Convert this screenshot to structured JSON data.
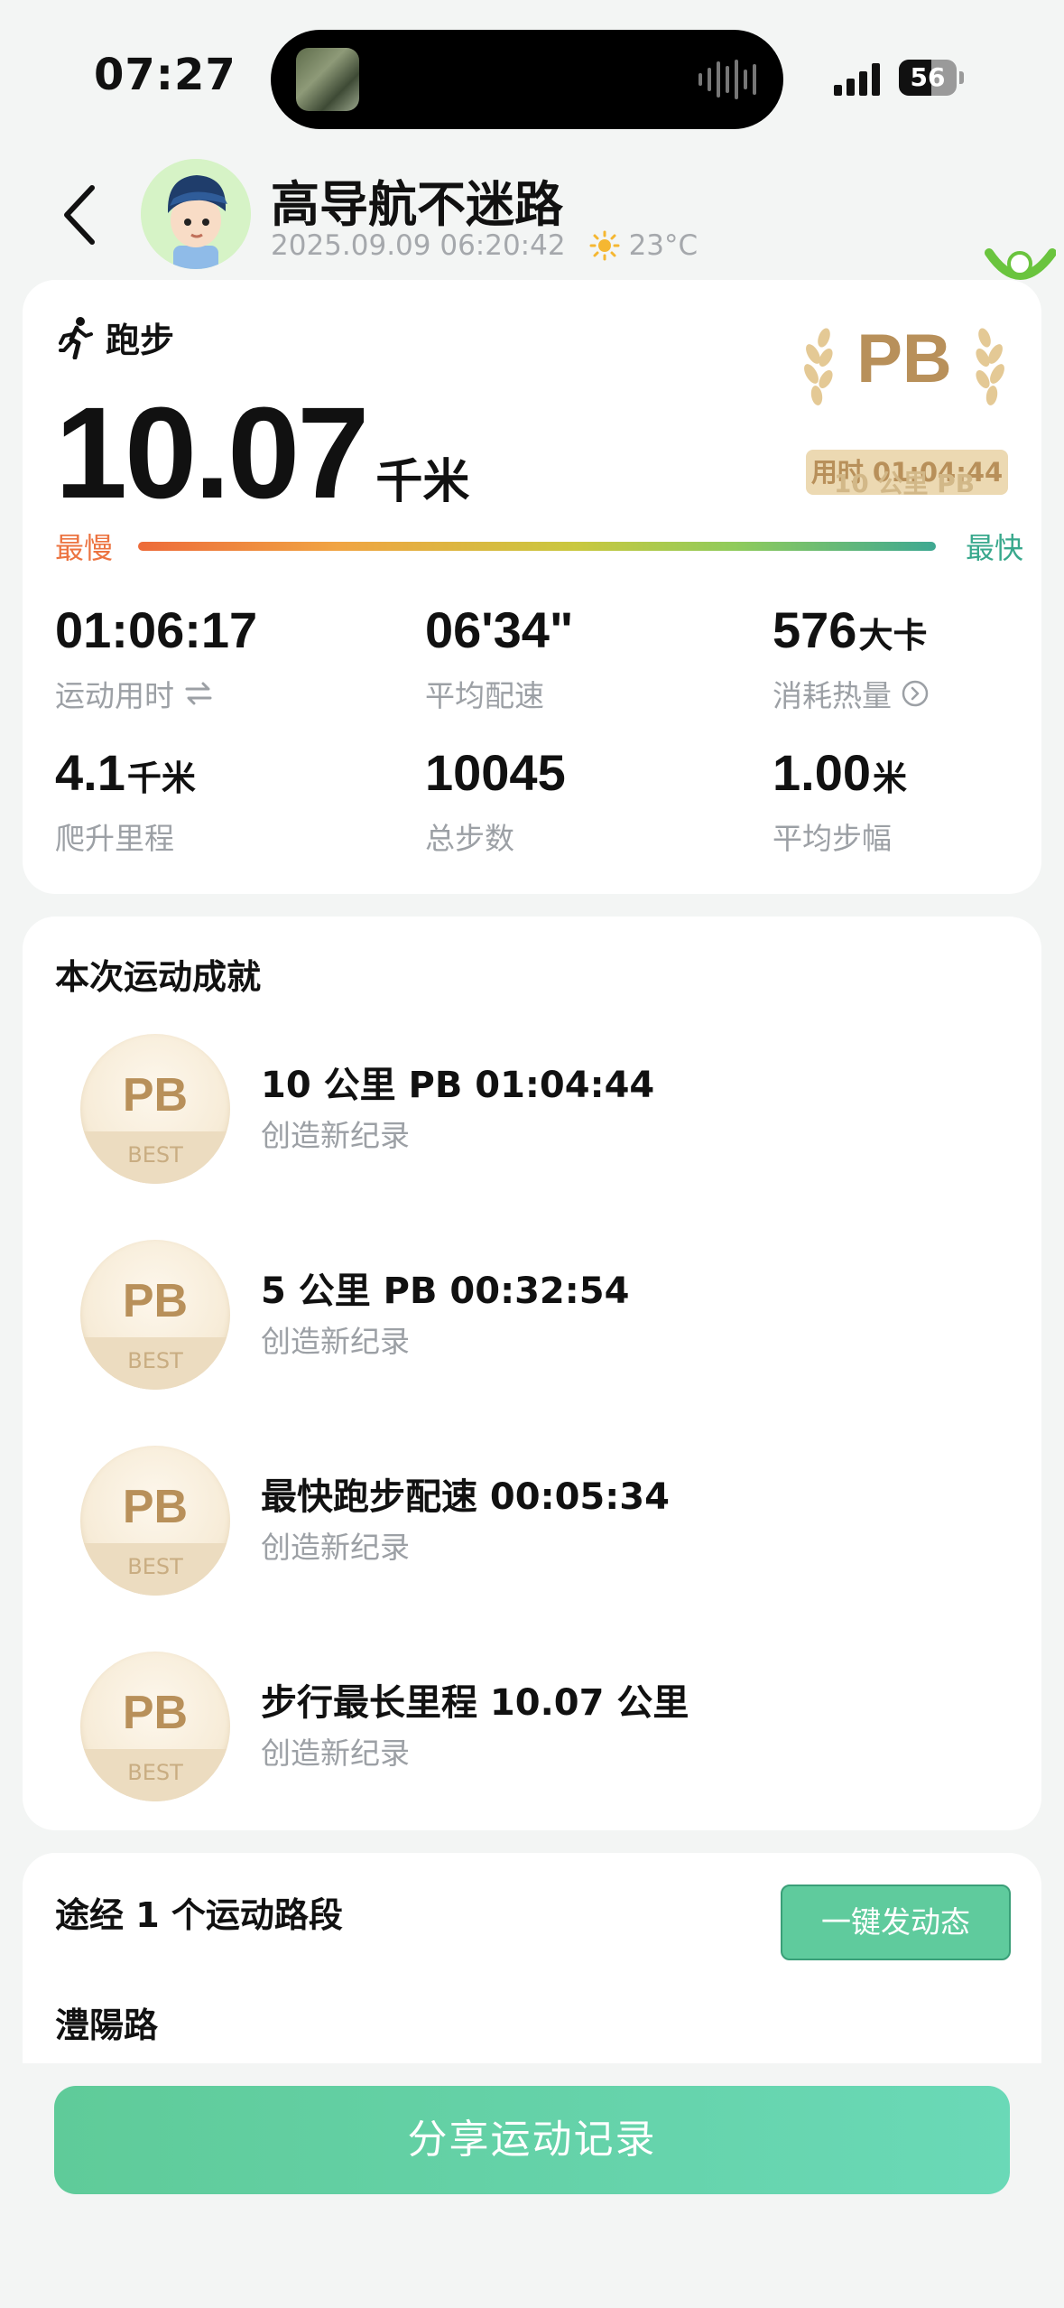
{
  "status_bar": {
    "time": "07:27",
    "battery": "56",
    "battery_level": 0.56
  },
  "header": {
    "user_name": "高导航不迷路",
    "datetime": "2025.09.09 06:20:42",
    "weather_icon": "sun-icon",
    "temperature": "23°C"
  },
  "summary": {
    "sport_type": "跑步",
    "distance_value": "10.07",
    "distance_unit": "千米",
    "pb_badge": "PB",
    "pb_time": "用时 01:04:44",
    "pb_desc": "10 公里 PB",
    "pace_slow_label": "最慢",
    "pace_fast_label": "最快",
    "colors": {
      "slow": "#ec7340",
      "fast": "#38a88c",
      "gold": "#b8905a"
    }
  },
  "stats": [
    {
      "value": "01:06:17",
      "unit": "",
      "label": "运动用时",
      "icon": "swap-icon"
    },
    {
      "value": "06'34\"",
      "unit": "",
      "label": "平均配速",
      "icon": ""
    },
    {
      "value": "576",
      "unit": "大卡",
      "label": "消耗热量",
      "icon": "chevron-circle-icon"
    },
    {
      "value": "4.1",
      "unit": "千米",
      "label": "爬升里程",
      "icon": ""
    },
    {
      "value": "10045",
      "unit": "",
      "label": "总步数",
      "icon": ""
    },
    {
      "value": "1.00",
      "unit": "米",
      "label": "平均步幅",
      "icon": ""
    }
  ],
  "achievements": {
    "title": "本次运动成就",
    "medal_text": "PB",
    "medal_sub": "BEST",
    "items": [
      {
        "title": "10 公里 PB 01:04:44",
        "subtitle": "创造新纪录"
      },
      {
        "title": "5 公里 PB 00:32:54",
        "subtitle": "创造新纪录"
      },
      {
        "title": "最快跑步配速 00:05:34",
        "subtitle": "创造新纪录"
      },
      {
        "title": "步行最长里程 10.07 公里",
        "subtitle": "创造新纪录"
      }
    ]
  },
  "segments": {
    "title": "途经 1 个运动路段",
    "post_button": "一键发动态",
    "first_segment": "澧陽路"
  },
  "share_button": "分享运动记录"
}
